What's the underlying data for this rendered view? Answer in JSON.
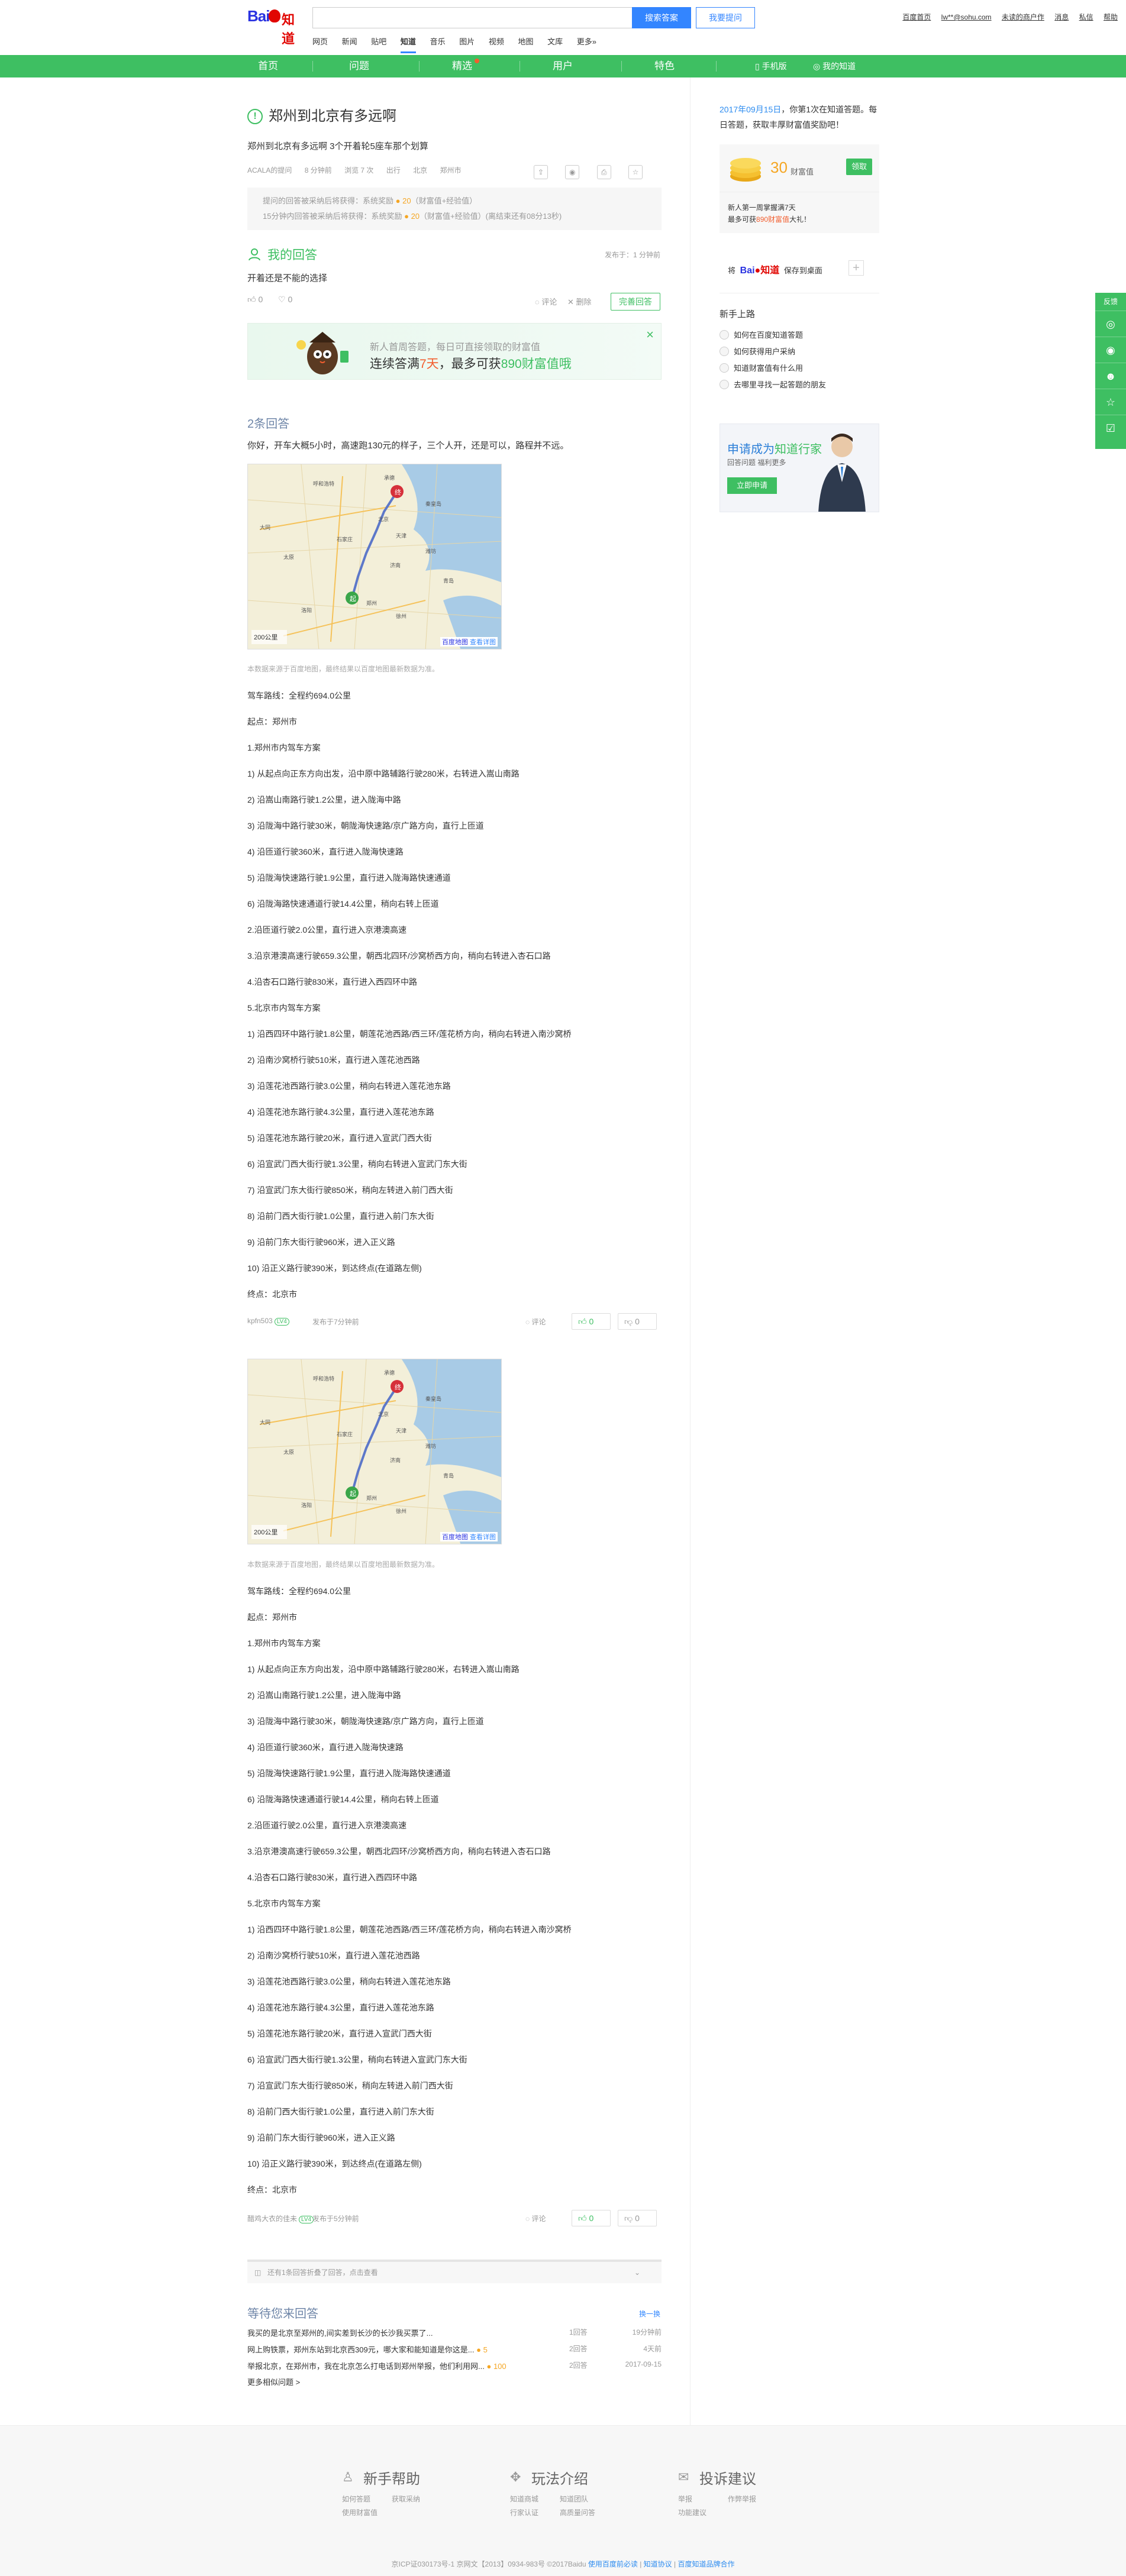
{
  "header": {
    "logo_text": "Bai知道",
    "search_placeholder": "",
    "search_button": "搜索答案",
    "ask_button": "我要提问",
    "user_links": [
      "百度首页",
      "lw**@sohu.com",
      "未读的商户作",
      "消息",
      "私信",
      "帮助"
    ],
    "channels": [
      {
        "label": "网页",
        "active": false
      },
      {
        "label": "新闻",
        "active": false
      },
      {
        "label": "贴吧",
        "active": false
      },
      {
        "label": "知道",
        "active": true
      },
      {
        "label": "音乐",
        "active": false
      },
      {
        "label": "图片",
        "active": false
      },
      {
        "label": "视频",
        "active": false
      },
      {
        "label": "地图",
        "active": false
      },
      {
        "label": "文库",
        "active": false
      },
      {
        "label": "更多»",
        "active": false
      }
    ]
  },
  "nav": {
    "items": [
      "首页",
      "问题",
      "精选",
      "用户",
      "特色"
    ],
    "mobile": "手机版",
    "my_zhidao": "我的知道"
  },
  "question": {
    "title": "郑州到北京有多远啊",
    "desc": "郑州到北京有多远啊 3个开着轮5座车那个划算",
    "meta": [
      "ACALA的提问",
      "8 分钟前",
      "浏览 7 次",
      "出行",
      "北京",
      "郑州市"
    ],
    "reward_lines": [
      {
        "text": "提问的回答被采纳后将获得：系统奖励",
        "coin": "20",
        "suffix": "（财富值+经验值）"
      },
      {
        "text": "15分钟内回答被采纳后将获得：系统奖励",
        "coin": "20",
        "suffix": "（财富值+经验值）(离结束还有08分13秒)"
      }
    ],
    "tool_icons": [
      "share-icon",
      "weibo-icon",
      "print-icon",
      "star-icon"
    ]
  },
  "my_answer": {
    "title": "我的回答",
    "time": "发布于：1 分钟前",
    "body": "开着还是不能的选择",
    "up": "0",
    "down": "0",
    "comment": "评论",
    "delete": "删除",
    "improve": "完善回答"
  },
  "promo": {
    "line1": "新人首周答题，每日可直接领取的财富值",
    "line2_prefix": "连续答满",
    "days": "7天",
    "line2_mid": "，最多可获",
    "reward": "890财富值哦"
  },
  "answers": {
    "count_label": "2条回答",
    "first_line": "你好，开车大概5小时，高速跑130元的样子，三个人开，还是可以，路程并不远。",
    "map_note": "本数据来源于百度地图，最终结果以百度地图最新数据为准。",
    "map_scale": "200公里",
    "map_brand": "百度地图",
    "map_link": "查看详图",
    "route_steps": [
      "驾车路线：全程约694.0公里",
      "起点：郑州市",
      "1.郑州市内驾车方案",
      "1) 从起点向正东方向出发，沿中原中路辅路行驶280米，右转进入嵩山南路",
      "2) 沿嵩山南路行驶1.2公里，进入陇海中路",
      "3) 沿陇海中路行驶30米，朝陇海快速路/京广路方向，直行上匝道",
      "4) 沿匝道行驶360米，直行进入陇海快速路",
      "5) 沿陇海快速路行驶1.9公里，直行进入陇海路快速通道",
      "6) 沿陇海路快速通道行驶14.4公里，稍向右转上匝道",
      "2.沿匝道行驶2.0公里，直行进入京港澳高速",
      "3.沿京港澳高速行驶659.3公里，朝西北四环/沙窝桥西方向，稍向右转进入杏石口路",
      "4.沿杏石口路行驶830米，直行进入西四环中路",
      "5.北京市内驾车方案",
      "1) 沿西四环中路行驶1.8公里，朝莲花池西路/西三环/莲花桥方向，稍向右转进入南沙窝桥",
      "2) 沿南沙窝桥行驶510米，直行进入莲花池西路",
      "3) 沿莲花池西路行驶3.0公里，稍向右转进入莲花池东路",
      "4) 沿莲花池东路行驶4.3公里，直行进入莲花池东路",
      "5) 沿莲花池东路行驶20米，直行进入宣武门西大街",
      "6) 沿宣武门西大街行驶1.3公里，稍向右转进入宣武门东大街",
      "7) 沿宣武门东大街行驶850米，稍向左转进入前门西大街",
      "8) 沿前门西大街行驶1.0公里，直行进入前门东大街",
      "9) 沿前门东大街行驶960米，进入正义路",
      "10) 沿正义路行驶390米，到达终点(在道路左侧)",
      "终点：北京市"
    ],
    "items": [
      {
        "user": "kpfn503",
        "level": "LV4",
        "time": "发布于7分钟前",
        "comment": "评论",
        "up": "0",
        "down": "0"
      },
      {
        "user": "醋鸡大衣的佳未",
        "level": "LV4",
        "time": "发布于5分钟前",
        "comment": "评论",
        "up": "0",
        "down": "0"
      }
    ]
  },
  "fold": {
    "text": "还有1条回答折叠了回答，点击查看"
  },
  "waiting": {
    "title": "等待您来回答",
    "change": "换一换",
    "items": [
      {
        "q": "我买的是北京至郑州的,间实差到长沙的长沙我买票了...",
        "count": "1回答",
        "time": "19分钟前",
        "coin": ""
      },
      {
        "q": "网上购铁票，郑州东站到北京西309元，哪大家和能知道是你这是...",
        "count": "2回答",
        "time": "4天前",
        "coin": "5"
      },
      {
        "q": "举报北京，在郑州市，我在北京怎么打电话到郑州举报，他们利用网...",
        "count": "2回答",
        "time": "2017-09-15",
        "coin": "100"
      }
    ],
    "more": "更多相似问题 >"
  },
  "sidebar": {
    "greeting_date": "2017年09月15日",
    "greeting_rest": "，你第1次在知道答题。每日答题，获取丰厚财富值奖励吧！",
    "coins": "30",
    "coins_unit": "财富值",
    "claim": "领取",
    "coin_line1": "新人第一周掌握满7天",
    "coin_line2_prefix": "最多可获",
    "coin_line2_num": "890财富值",
    "coin_line2_suffix": "大礼！",
    "desktop_prefix": "将",
    "desktop_text": "保存到桌面",
    "guide_title": "新手上路",
    "guide_items": [
      "如何在百度知道答题",
      "如何获得用户采纳",
      "知道财富值有什么用",
      "去哪里寻找一起答题的朋友"
    ],
    "ad_title_1": "申请成为",
    "ad_title_2": "知道行家",
    "ad_sub": "回答问题 福利更多",
    "ad_btn": "立即申请"
  },
  "float": {
    "top": "反馈",
    "icons": [
      "wechat-icon",
      "weibo-icon",
      "qq-icon",
      "star-icon",
      "checkin-icon"
    ]
  },
  "footer": {
    "cols": [
      {
        "title": "新手帮助",
        "links": [
          "如何答题",
          "获取采纳",
          "使用财富值"
        ]
      },
      {
        "title": "玩法介绍",
        "links": [
          "知道商城",
          "知道团队",
          "行家认证",
          "高质量问答"
        ]
      },
      {
        "title": "投诉建议",
        "links": [
          "举报",
          "作弊举报",
          "功能建议"
        ]
      }
    ],
    "copyright": "京ICP证030173号-1   京网文【2013】0934-983号   ©2017Baidu",
    "terms1": "使用百度前必读",
    "terms2": "知道协议",
    "terms3": "百度知道品牌合作"
  }
}
